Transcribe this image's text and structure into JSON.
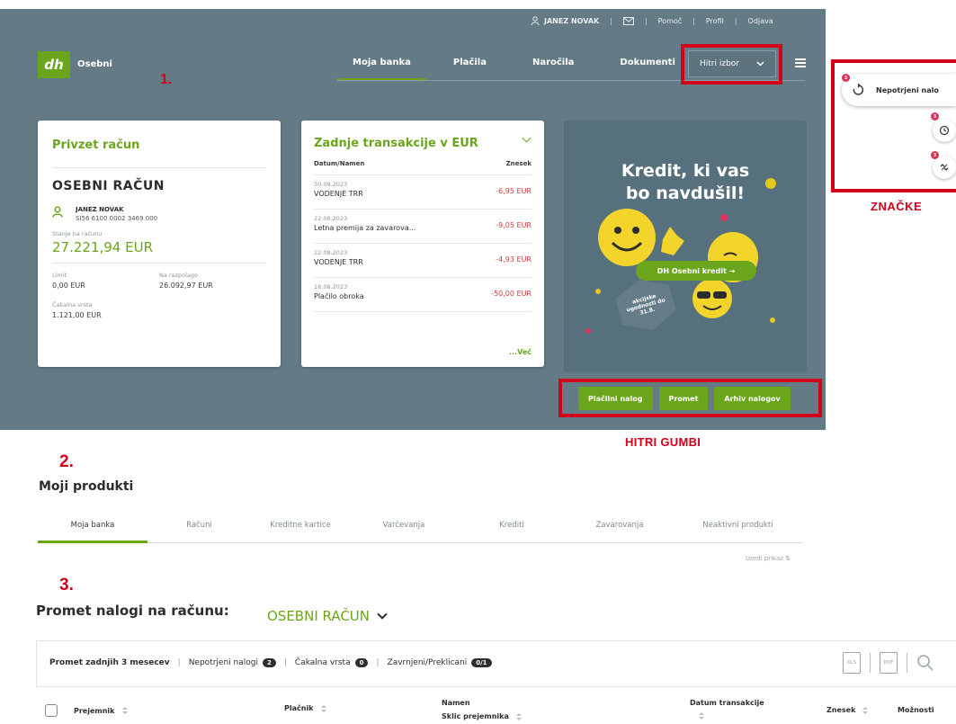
{
  "topbar": {
    "user": "JANEZ NOVAK",
    "links": [
      "Pomoč",
      "Profil",
      "Odjava"
    ]
  },
  "brand": {
    "logo": "dh",
    "label": "Osebni"
  },
  "annotations": {
    "m1": "1.",
    "m2": "2.",
    "m3": "3.",
    "quick_buttons": "HITRI GUMBI",
    "badges": "ZNAČKE"
  },
  "nav": {
    "items": [
      "Moja banka",
      "Plačila",
      "Naročila",
      "Dokumenti"
    ],
    "active": "Moja banka",
    "quick_select": "Hitri izbor"
  },
  "default_account": {
    "title": "Privzet račun",
    "name": "OSEBNI RAČUN",
    "holder": "JANEZ NOVAK",
    "iban": "SI56 6100 0002 3469 000",
    "balance_label": "Stanje na računu",
    "balance": "27.221,94 EUR",
    "limit_label": "Limit",
    "limit": "0,00 EUR",
    "available_label": "Na razpolago",
    "available": "26.092,97 EUR",
    "queue_label": "Čakalna vrsta",
    "queue": "1.121,00 EUR"
  },
  "transactions": {
    "title": "Zadnje transakcije v EUR",
    "col_date": "Datum/Namen",
    "col_amount": "Znesek",
    "rows": [
      {
        "date": "30.09.2023",
        "name": "VODENJE TRR",
        "amount": "-6,95 EUR"
      },
      {
        "date": "22.08.2023",
        "name": "Letna premija za zavarova...",
        "amount": "-9,05 EUR"
      },
      {
        "date": "22.08.2023",
        "name": "VODENJE TRR",
        "amount": "-4,93 EUR"
      },
      {
        "date": "18.08.2023",
        "name": "Plačilo obroka",
        "amount": "-50,00 EUR"
      }
    ],
    "more": "...Več"
  },
  "promo": {
    "line1": "Kredit, ki vas",
    "line2": "bo navdušil!",
    "button": "DH Osebni kredit →",
    "badge": "akcijske ugodnosti do 31.8."
  },
  "quick_buttons": [
    "Plačilni nalog",
    "Promet",
    "Arhiv nalogov"
  ],
  "badges": {
    "pending_label": "Nepotrjeni nalo",
    "counts": [
      "3",
      "3",
      "3"
    ]
  },
  "products": {
    "title": "Moji produkti",
    "tabs": [
      "Moja banka",
      "Računi",
      "Kreditne kartice",
      "Varčevanja",
      "Krediti",
      "Zavarovanja",
      "Neaktivni produkti"
    ],
    "active": "Moja banka",
    "edit_view": "Uredi prikaz"
  },
  "orders": {
    "title": "Promet nalogi na računu:",
    "account": "OSEBNI RAČUN",
    "filters": [
      {
        "label": "Promet zadnjih 3 mesecev",
        "count": ""
      },
      {
        "label": "Nepotrjeni nalogi",
        "count": "2"
      },
      {
        "label": "Čakalna vrsta",
        "count": "0"
      },
      {
        "label": "Zavrnjeni/Preklicani",
        "count": "0/1"
      }
    ],
    "tools": {
      "xls": "XLS",
      "pdf": "PDF"
    },
    "columns": {
      "recipient": "Prejemnik",
      "payer": "Plačnik",
      "purpose": "Namen",
      "reference": "Sklic prejemnika",
      "date": "Datum transakcije",
      "amount": "Znesek",
      "options": "Možnosti"
    }
  },
  "colors": {
    "accent": "#6aa51b",
    "hero": "#647b86",
    "annotation": "#d3001b"
  }
}
